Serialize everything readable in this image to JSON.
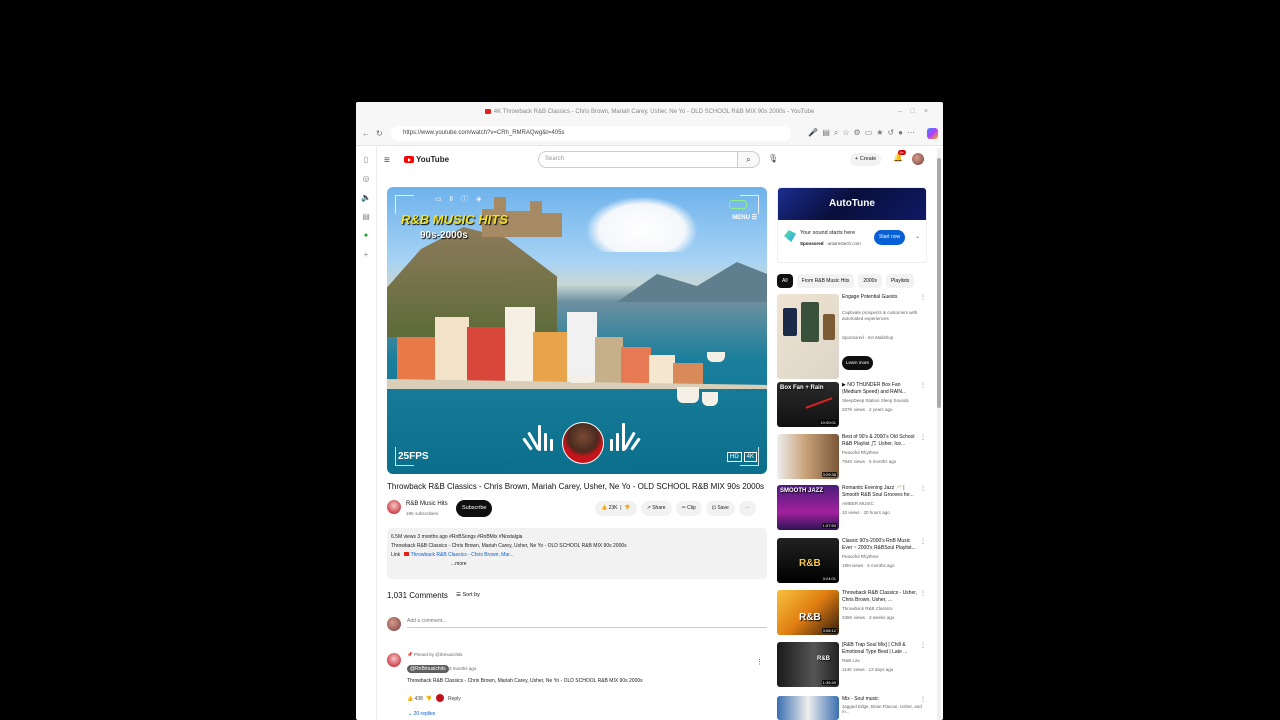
{
  "browser": {
    "tab_title": "4K Throwback R&B Classics - Chris Brown, Mariah Carey, Usher, Ne Yo - OLD SCHOOL R&B MIX 90s 2000s - YouTube",
    "url": "https://www.youtube.com/watch?v=CRh_RMRAQwg&t=405s"
  },
  "youtube": {
    "logo": "YouTube",
    "search_placeholder": "Search",
    "create_label": "Create",
    "notification_count": "9+"
  },
  "player": {
    "overlay_title": "R&B MUSIC HITS",
    "overlay_subtitle": "90s-2000s",
    "menu_label": "MENU",
    "fps_label": "25FPS",
    "hd_label": "HD",
    "res_label": "4K"
  },
  "video": {
    "title": "Throwback R&B Classics - Chris Brown, Mariah Carey, Usher, Ne Yo - OLD SCHOOL R&B MIX 90s 2000s",
    "channel": "R&B Music Hits",
    "subscribers": "18K subscribers",
    "subscribe_label": "Subscribe",
    "likes": "23K",
    "share_label": "Share",
    "clip_label": "Clip",
    "save_label": "Save",
    "meta": "6.5M views  3 months ago  #RnBSongs #RnBMix #Nostalgia",
    "desc_line": "Throwback R&B Classics - Chris Brown, Mariah Carey, Usher, Ne Yo - OLD SCHOOL R&B MIX 90s 2000s",
    "desc_link_label": "Link",
    "desc_link": "Throwback R&B Classics - Chris Brown, Mar...",
    "more_label": "...more"
  },
  "comments": {
    "count": "1,031 Comments",
    "sort_label": "Sort by",
    "add_placeholder": "Add a comment...",
    "pinned_label": "Pinned by @rbmusichits",
    "author": "@RnBmusichits",
    "time": "3 months ago",
    "text": "Throwback R&B Classics - Chris Brown, Mariah Carey, Usher, Ne Yo - OLD SCHOOL R&B MIX 90s 2000s",
    "likes": "438",
    "reply_label": "Reply",
    "replies_label": "20 replies"
  },
  "ad": {
    "brand": "AutoTune",
    "tagline": "Your sound starts here",
    "sponsored": "Sponsored",
    "domain": "antarestech.com",
    "cta": "Start now"
  },
  "chips": [
    "All",
    "From R&B Music Hits",
    "2000s",
    "Playlists"
  ],
  "recommendations": [
    {
      "title": "Engage Potential Guests",
      "line1": "Captivate prospects & customers with automated experiences",
      "line2": "Sponsored · Inn Mailshop",
      "cta": "Learn more",
      "duration": "",
      "thumb_label": ""
    },
    {
      "title": "▶ NO THUNDER Box Fan (Medium Speed) and RAIN...",
      "channel": "SleepDeep Station Sleep Sounds",
      "views": "337K views · 2 years ago",
      "duration": "10:00:01",
      "thumb_label": "Box Fan + Rain"
    },
    {
      "title": "Best of 90's & 2000's Old School R&B Playlist 🎵 Usher, Ice...",
      "channel": "Peaceful Rhythms",
      "views": "794K views · 5 months ago",
      "duration": "3:29:38",
      "thumb_label": ""
    },
    {
      "title": "Romantic Evening Jazz 🥂 | Smooth R&B Soul Grooves for...",
      "channel": "AMBER MUSIC",
      "views": "10 views · 20 hours ago",
      "duration": "1:57:50",
      "thumb_label": "SMOOTH JAZZ"
    },
    {
      "title": "Classic 90's-2000's RnB Music Ever ~ 2000's R&BSoul Playlist...",
      "channel": "Peaceful Rhythms",
      "views": "19M views · 5 months ago",
      "duration": "3:24:01",
      "thumb_label": "R&B"
    },
    {
      "title": "Throwback R&B Classics - Usher, Chris Brown, Usher, ...",
      "channel": "Throwback R&B Classics",
      "views": "336K views · 3 weeks ago",
      "duration": "3:08:12",
      "thumb_label": "R&B"
    },
    {
      "title": "[R&B Trap Soul Mix] | Chill & Emotional Type Beat | Late ...",
      "channel": "R&B Lav",
      "views": "114K views · 13 days ago",
      "duration": "1:39:49",
      "thumb_label": "R&B"
    },
    {
      "title": "Mix - Soul music",
      "channel": "Jagged Edge, Brian Flavour, Usher, and m...",
      "views": "",
      "duration": "",
      "thumb_label": ""
    }
  ]
}
